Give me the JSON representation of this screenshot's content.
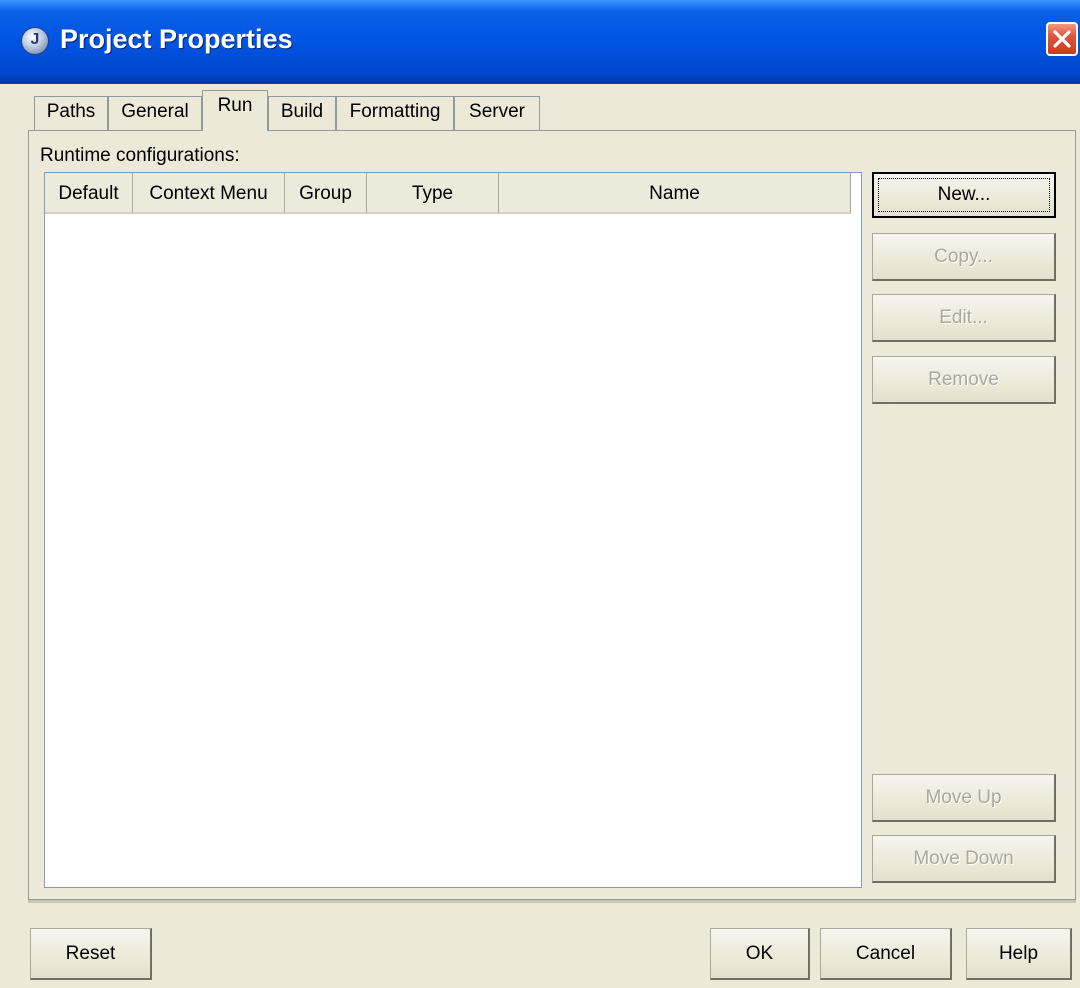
{
  "window": {
    "title": "Project Properties",
    "icon": "app-icon",
    "close_icon": "close-icon"
  },
  "tabs": [
    {
      "label": "Paths",
      "active": false
    },
    {
      "label": "General",
      "active": false
    },
    {
      "label": "Run",
      "active": true
    },
    {
      "label": "Build",
      "active": false
    },
    {
      "label": "Formatting",
      "active": false
    },
    {
      "label": "Server",
      "active": false
    }
  ],
  "run": {
    "label": "Runtime configurations:",
    "columns": [
      "Default",
      "Context Menu",
      "Group",
      "Type",
      "Name"
    ],
    "rows": []
  },
  "side_buttons": {
    "new": "New...",
    "copy": "Copy...",
    "edit": "Edit...",
    "remove": "Remove",
    "move_up": "Move Up",
    "move_down": "Move Down"
  },
  "footer": {
    "reset": "Reset",
    "ok": "OK",
    "cancel": "Cancel",
    "help": "Help"
  },
  "colors": {
    "titlebar": "#0054e3",
    "face": "#ece9d8",
    "disabled_text": "#aca899"
  }
}
